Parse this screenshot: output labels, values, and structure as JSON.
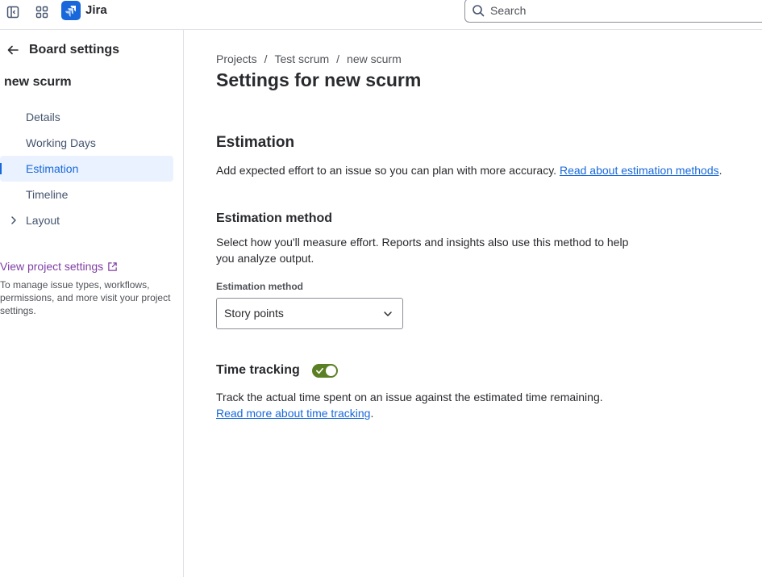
{
  "topbar": {
    "app_name": "Jira",
    "search_placeholder": "Search",
    "brand_color": "#1868db"
  },
  "sidebar": {
    "back_title": "Board settings",
    "board_name": "new scurm",
    "items": [
      {
        "label": "Details",
        "active": false
      },
      {
        "label": "Working Days",
        "active": false
      },
      {
        "label": "Estimation",
        "active": true
      },
      {
        "label": "Timeline",
        "active": false
      },
      {
        "label": "Layout",
        "active": false,
        "expandable": true
      }
    ],
    "project_link": "View project settings",
    "project_desc": "To manage issue types, workflows, permissions, and more visit your project settings."
  },
  "main": {
    "breadcrumb": [
      "Projects",
      "Test scrum",
      "new scurm"
    ],
    "breadcrumb_separator": "/",
    "page_title": "Settings for new scurm",
    "estimation": {
      "title": "Estimation",
      "desc": "Add expected effort to an issue so you can plan with more accuracy. ",
      "link": "Read about estimation methods",
      "link_suffix": "."
    },
    "method": {
      "title": "Estimation method",
      "desc": "Select how you'll measure effort. Reports and insights also use this method to help you analyze output.",
      "field_label": "Estimation method",
      "selected": "Story points"
    },
    "time_tracking": {
      "title": "Time tracking",
      "enabled": true,
      "desc": "Track the actual time spent on an issue against the estimated time remaining.",
      "link": "Read more about time tracking",
      "link_suffix": "."
    }
  }
}
